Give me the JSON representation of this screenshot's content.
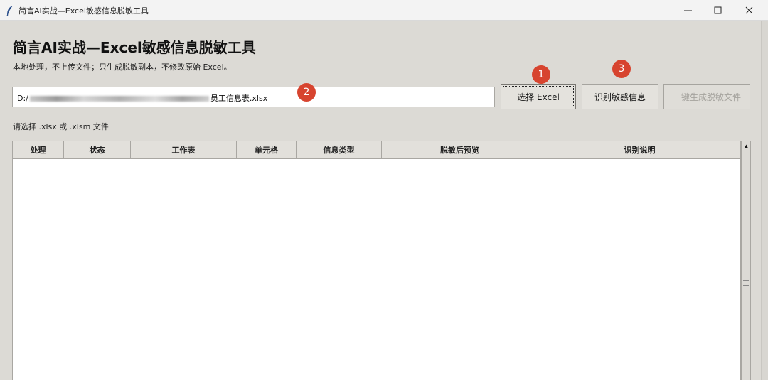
{
  "window": {
    "title": "简言AI实战—Excel敏感信息脱敏工具",
    "app_icon": "feather-icon",
    "controls": [
      "minimize-icon",
      "maximize-icon",
      "close-icon"
    ]
  },
  "header": {
    "title": "简言AI实战—Excel敏感信息脱敏工具",
    "subtitle": "本地处理，不上传文件；只生成脱敏副本，不修改原始 Excel。"
  },
  "file": {
    "path_prefix": "D:/",
    "path_suffix": "员工信息表.xlsx"
  },
  "buttons": {
    "select": "选择 Excel",
    "identify": "识别敏感信息",
    "generate": "一键生成脱敏文件"
  },
  "badges": [
    "1",
    "2",
    "3"
  ],
  "status_text": "请选择 .xlsx 或 .xlsm 文件",
  "table": {
    "columns": [
      "处理",
      "状态",
      "工作表",
      "单元格",
      "信息类型",
      "脱敏后预览",
      "识别说明"
    ],
    "rows": []
  },
  "colors": {
    "badge": "#d7442f",
    "window_bg": "#dcdad5"
  }
}
